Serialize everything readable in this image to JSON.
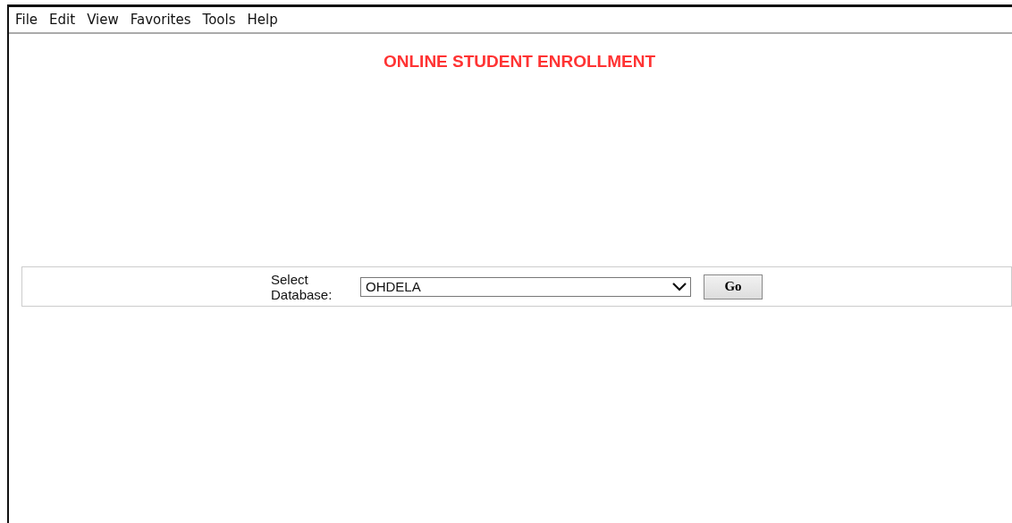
{
  "menu": [
    "File",
    "Edit",
    "View",
    "Favorites",
    "Tools",
    "Help"
  ],
  "title": "ONLINE STUDENT ENROLLMENT",
  "database": {
    "label": "Select Database:",
    "value": "OHDELA"
  },
  "buttons": [
    "Go"
  ]
}
